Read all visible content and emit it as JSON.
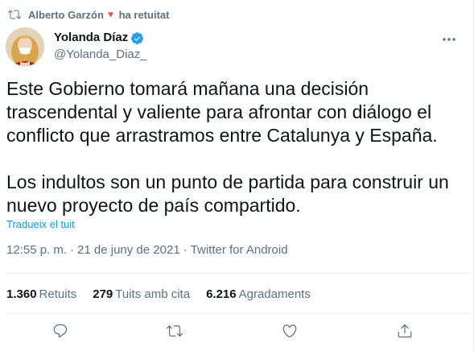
{
  "retweet_context": {
    "name": "Alberto Garzón",
    "flower": "🔻",
    "suffix": "ha retuitat"
  },
  "author": {
    "display_name": "Yolanda Díaz",
    "handle": "@Yolanda_Diaz_",
    "verified": true
  },
  "tweet": {
    "paragraph_1": "Este Gobierno tomará mañana una decisión trascendental y valiente para afrontar con diálogo el conflicto que arrastramos entre Catalunya y España.",
    "paragraph_2": "Los indultos son un punto de partida para construir un nuevo proyecto de país compartido.",
    "translate_label": "Tradueix el tuit"
  },
  "meta": {
    "time": "12:55 p. m.",
    "date": "21 de juny de 2021",
    "source": "Twitter for Android",
    "separator": "·"
  },
  "stats": {
    "retweets": "1.360",
    "retweets_label": "Retuits",
    "quotes": "279",
    "quotes_label": "Tuits amb cita",
    "likes": "6.216",
    "likes_label": "Agradaments"
  },
  "colors": {
    "accent": "#1da1f2",
    "secondary_text": "#5b7083",
    "link": "#1b95e0",
    "flower": "#e0245e"
  },
  "icons": {
    "retweet_context": "retweet-icon",
    "verified": "verified-badge-icon",
    "more": "more-icon",
    "reply": "reply-icon",
    "retweet": "retweet-icon",
    "like": "heart-icon",
    "share": "share-icon"
  }
}
